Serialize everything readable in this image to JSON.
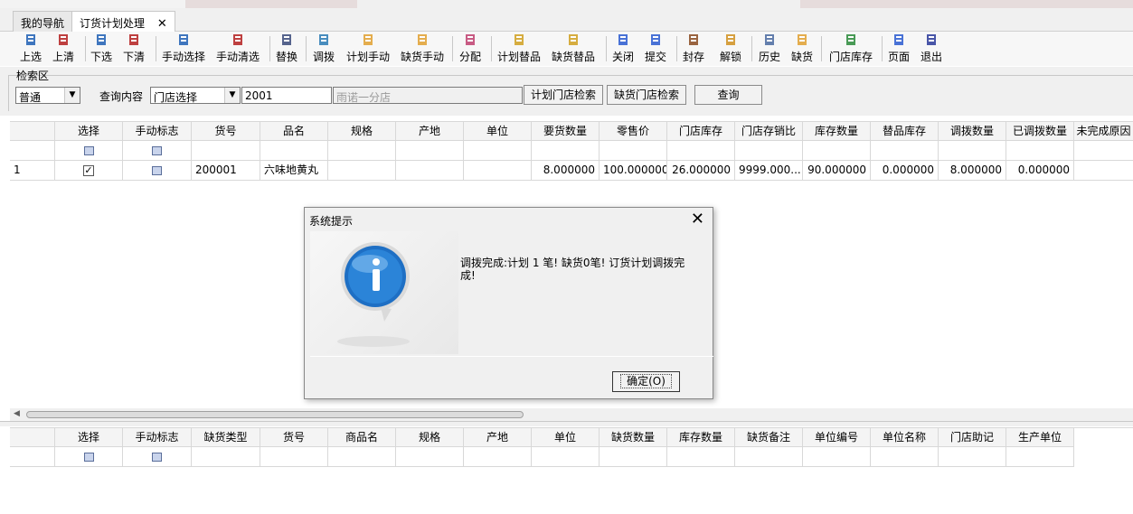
{
  "tabs": [
    {
      "label": "我的导航"
    },
    {
      "label": "订货计划处理",
      "close": "✕"
    }
  ],
  "toolbar": [
    {
      "label": "上选",
      "icon": "list-up-icon",
      "color": "#1f5fb4"
    },
    {
      "label": "上清",
      "icon": "list-clear-icon",
      "color": "#b42020"
    },
    {
      "label": "下选",
      "icon": "list-down-icon",
      "color": "#1f5fb4"
    },
    {
      "label": "下清",
      "icon": "list-clear-icon",
      "color": "#b42020"
    },
    {
      "label": "手动选择",
      "icon": "list-select-icon",
      "color": "#1f5fb4"
    },
    {
      "label": "手动清选",
      "icon": "list-clear-icon",
      "color": "#b42020"
    },
    {
      "label": "替换",
      "icon": "replace-icon",
      "color": "#3a4a7a"
    },
    {
      "label": "调拨",
      "icon": "globe-icon",
      "color": "#2a7ab4"
    },
    {
      "label": "计划手动",
      "icon": "folder-icon",
      "color": "#e0a030"
    },
    {
      "label": "缺货手动",
      "icon": "folder-icon",
      "color": "#e0a030"
    },
    {
      "label": "分配",
      "icon": "distribute-icon",
      "color": "#c04070"
    },
    {
      "label": "计划替品",
      "icon": "swap-icon",
      "color": "#d0a020"
    },
    {
      "label": "缺货替品",
      "icon": "swap-icon",
      "color": "#d0a020"
    },
    {
      "label": "关闭",
      "icon": "close-square-icon",
      "color": "#2a5ad0"
    },
    {
      "label": "提交",
      "icon": "submit-square-icon",
      "color": "#2a5ad0"
    },
    {
      "label": "封存",
      "icon": "seal-icon",
      "color": "#8a4a20"
    },
    {
      "label": "解锁",
      "icon": "lock-icon",
      "color": "#d09020"
    },
    {
      "label": "历史",
      "icon": "history-icon",
      "color": "#4a6aa0"
    },
    {
      "label": "缺货",
      "icon": "folder-icon",
      "color": "#e0a030"
    },
    {
      "label": "门店库存",
      "icon": "store-icon",
      "color": "#2a8a3a"
    },
    {
      "label": "页面",
      "icon": "page-icon",
      "color": "#2a5ad0"
    },
    {
      "label": "退出",
      "icon": "exit-icon",
      "color": "#2a3a9a"
    }
  ],
  "search": {
    "title": "检索区",
    "mode": "普通",
    "query_label": "查询内容",
    "store_select": "门店选择",
    "code_value": "2001",
    "store_name": "雨诺一分店",
    "btn_plan": "计划门店检索",
    "btn_short": "缺货门店检索",
    "btn_query": "查询"
  },
  "top_grid": {
    "headers": [
      "选择",
      "手动标志",
      "货号",
      "品名",
      "规格",
      "产地",
      "单位",
      "要货数量",
      "零售价",
      "门店库存",
      "门店存销比",
      "库存数量",
      "替品库存",
      "调拨数量",
      "已调拨数量",
      "未完成原因"
    ],
    "rows": [
      {
        "index": "1",
        "selected": "✓",
        "code": "200001",
        "name": "六味地黄丸",
        "spec": "",
        "origin": "",
        "unit": "",
        "req_qty": "8.000000",
        "price": "100.000000",
        "store_stock": "26.000000",
        "ratio": "9999.000...",
        "stock_qty": "90.000000",
        "sub_stock": "0.000000",
        "transfer_qty": "8.000000",
        "transferred": "0.000000",
        "reason": ""
      }
    ]
  },
  "bottom_grid": {
    "headers": [
      "选择",
      "手动标志",
      "缺货类型",
      "货号",
      "商品名",
      "规格",
      "产地",
      "单位",
      "缺货数量",
      "库存数量",
      "缺货备注",
      "单位编号",
      "单位名称",
      "门店助记",
      "生产单位"
    ]
  },
  "dialog": {
    "title": "系统提示",
    "close": "✕",
    "message": "调拨完成:计划 1 笔! 缺货0笔! 订货计划调拨完成!",
    "ok": "确定(O)"
  }
}
